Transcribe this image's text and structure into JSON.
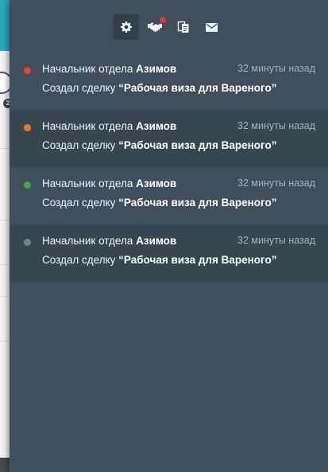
{
  "toolbar": {
    "buttons": [
      {
        "icon": "gear-icon",
        "active": true,
        "badge": false
      },
      {
        "icon": "handshake-icon",
        "active": false,
        "badge": true
      },
      {
        "icon": "documents-icon",
        "active": false,
        "badge": false
      },
      {
        "icon": "envelope-icon",
        "active": false,
        "badge": false
      }
    ],
    "badge_color": "#e0382f"
  },
  "notifications": [
    {
      "role": "Начальник отдела",
      "name": "Азимов",
      "time": "32 минуты назад",
      "action": "Создал сделку",
      "subject": "“Рабочая виза для Вареного”",
      "dot_color": "#e5432f"
    },
    {
      "role": "Начальник отдела",
      "name": "Азимов",
      "time": "32 минуты назад",
      "action": "Создал сделку",
      "subject": "“Рабочая виза для Вареного”",
      "dot_color": "#f07a21"
    },
    {
      "role": "Начальник отдела",
      "name": "Азимов",
      "time": "32 минуты назад",
      "action": "Создал сделку",
      "subject": "“Рабочая виза для Вареного”",
      "dot_color": "#3ea84a"
    },
    {
      "role": "Начальник отдела",
      "name": "Азимов",
      "time": "32 минуты назад",
      "action": "Создал сделку",
      "subject": "“Рабочая виза для Вареного”",
      "dot_color": "#74848e"
    }
  ],
  "colors": {
    "panel": "#3f4f5b",
    "panel_alt": "#38474f",
    "accent": "#2aaabf"
  }
}
